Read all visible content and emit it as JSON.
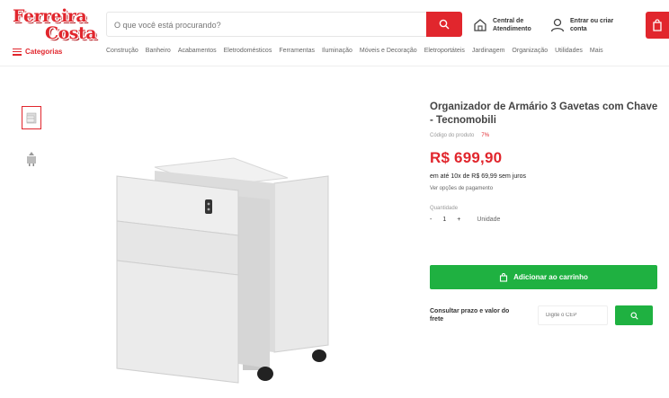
{
  "header": {
    "logo_line1": "Ferreira",
    "logo_line2": "Costa",
    "search_placeholder": "O que você está procurando?",
    "store_locator": "Central de Atendimento",
    "account": "Entrar ou criar conta",
    "categories_label": "Categorias",
    "nav": [
      "Construção",
      "Banheiro",
      "Acabamentos",
      "Eletrodomésticos",
      "Ferramentas",
      "Iluminação",
      "Móveis e Decoração",
      "Eletroportáteis",
      "Jardinagem",
      "Organização",
      "Utilidades",
      "Mais"
    ]
  },
  "colors": {
    "brand_red": "#e1262d",
    "buy_green": "#1fb141"
  },
  "product": {
    "title": "Organizador de Armário 3 Gavetas com Chave - Tecnomobili",
    "code_label": "Código do produto",
    "badge": "7%",
    "price": "R$ 699,90",
    "installments": "em até 10x de R$ 69,99 sem juros",
    "payment_link": "Ver opções de pagamento",
    "qty_label": "Quantidade",
    "qty_minus": "-",
    "qty_value": "1",
    "qty_plus": "+",
    "qty_unit": "Unidade",
    "add_to_cart": "Adicionar ao carrinho",
    "shipping_label": "Consultar prazo e valor do frete",
    "cep_placeholder": "Digite o CEP"
  },
  "icons": {
    "search": "search-icon",
    "store": "store-icon",
    "user": "user-icon",
    "cart": "cart-icon",
    "menu": "menu-icon"
  }
}
